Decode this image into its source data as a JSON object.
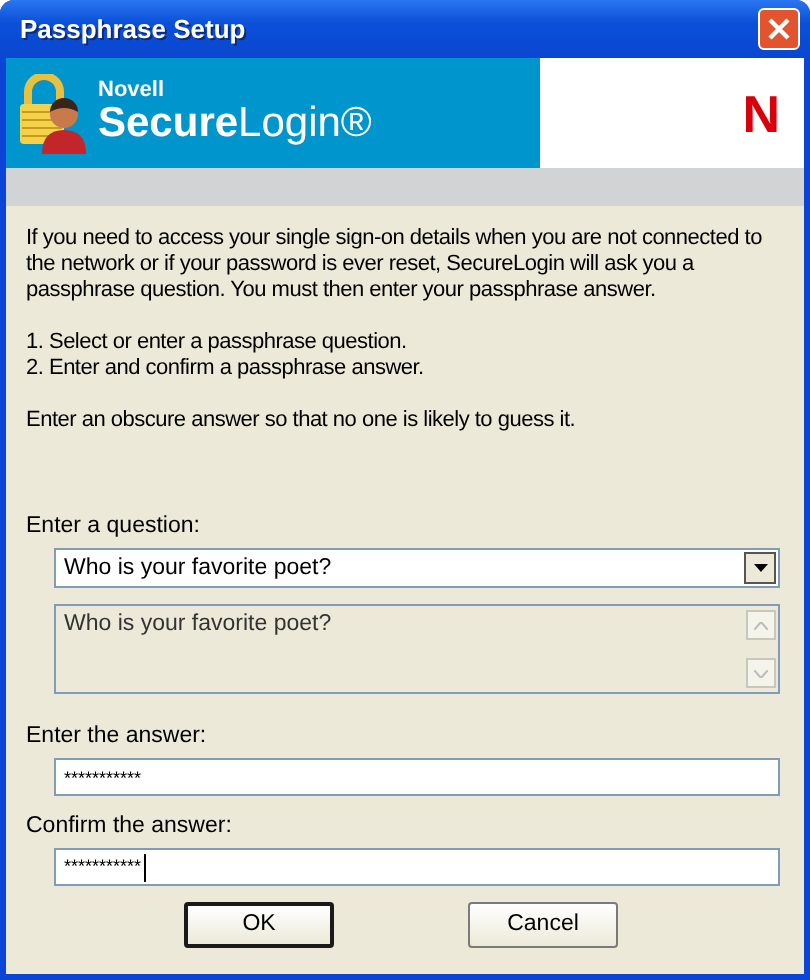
{
  "window": {
    "title": "Passphrase Setup"
  },
  "banner": {
    "brand": "Novell",
    "product": "**Secure**Login®",
    "logo_letter": "N"
  },
  "instructions": [
    "If you need to access your single sign-on details when you are not connected to the network or if your password is ever reset, SecureLogin will ask you a passphrase question. You must then enter your passphrase answer.",
    "1. Select or enter a passphrase question.\n2. Enter and confirm a passphrase answer.",
    "Enter an obscure answer so that no one is likely to guess it."
  ],
  "question": {
    "label": "Enter a question:",
    "value": "Who is your favorite poet?",
    "preview": "Who is your favorite poet?"
  },
  "answer": {
    "label": "Enter the answer:",
    "value": "***********"
  },
  "confirm": {
    "label": "Confirm the answer:",
    "value": "***********",
    "focused": true
  },
  "buttons": [
    {
      "label": "OK",
      "default": true
    },
    {
      "label": "Cancel",
      "default": false
    }
  ]
}
